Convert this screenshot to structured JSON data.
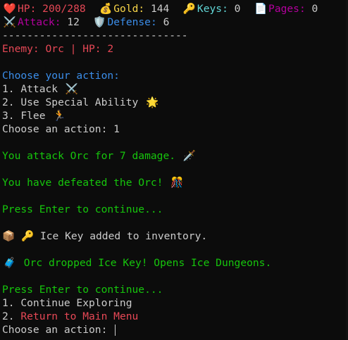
{
  "stats": {
    "hp_icon": "❤️",
    "hp_label": "HP:",
    "hp_value": "200/288",
    "gold_icon": "💰",
    "gold_label": "Gold:",
    "gold_value": "144",
    "keys_icon": "🔑",
    "keys_label": "Keys:",
    "keys_value": "0",
    "pages_icon": "📄",
    "pages_label": "Pages:",
    "pages_value": "0",
    "attack_icon": "⚔️",
    "attack_label": "Attack:",
    "attack_value": "12",
    "defense_icon": "🛡️",
    "defense_label": "Defense:",
    "defense_value": "6"
  },
  "divider": "------------------------------",
  "enemy": {
    "text": "Enemy: Orc | HP: 2"
  },
  "combat_menu": {
    "title": "Choose your action:",
    "options": [
      {
        "label": "1. Attack",
        "icon": "⚔️"
      },
      {
        "label": "2. Use Special Ability",
        "icon": "🌟"
      },
      {
        "label": "3. Flee",
        "icon": "🏃"
      }
    ],
    "prompt": "Choose an action: 1"
  },
  "messages": {
    "attack": "You attack Orc for 7 damage.",
    "attack_icon": "🗡️",
    "defeated": "You have defeated the Orc!",
    "defeated_icon": "🎊",
    "press_enter_1": "Press Enter to continue...",
    "inventory_icons": "📦 🔑",
    "inventory": "Ice Key added to inventory.",
    "drop_icon": "🧳",
    "drop": "Orc dropped Ice Key! Opens Ice Dungeons.",
    "press_enter_2": "Press Enter to continue..."
  },
  "main_menu": {
    "option1": "1. Continue Exploring",
    "option2_num": "2. ",
    "option2_label": "Return to Main Menu",
    "prompt": "Choose an action: "
  },
  "colors": {
    "background": "#0c0c0c",
    "red": "#e74856",
    "yellow": "#f9d649",
    "cyan": "#61d6d6",
    "magenta": "#b4009e",
    "blue": "#3b8eea",
    "green": "#16c60c",
    "text": "#cccccc"
  }
}
